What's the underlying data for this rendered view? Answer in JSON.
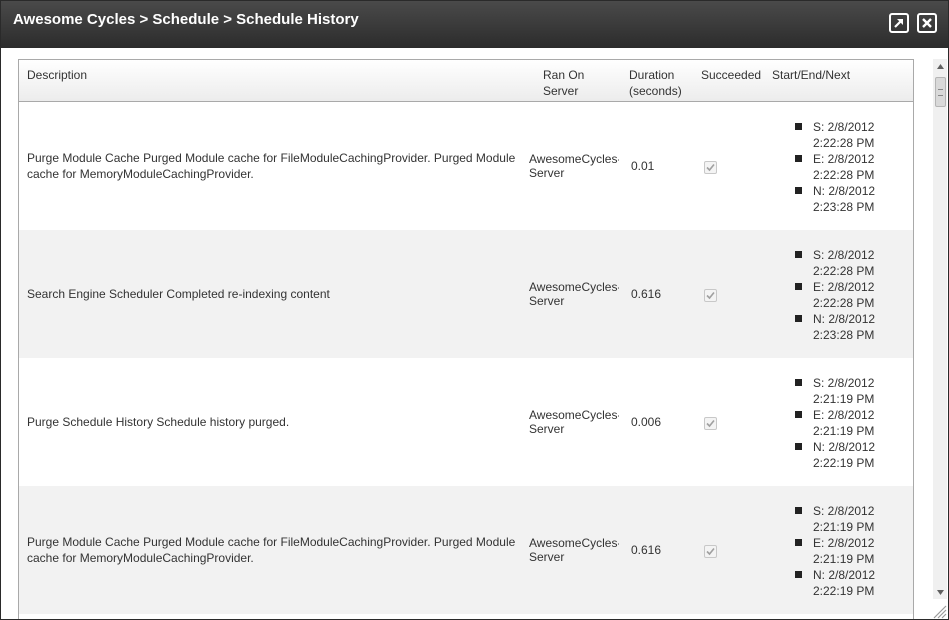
{
  "dialog": {
    "title": "Awesome Cycles > Schedule > Schedule History",
    "maximize_icon": "maximize-icon",
    "close_icon": "close-icon"
  },
  "grid": {
    "columns": {
      "description": "Description",
      "server_line1": "Ran On",
      "server_line2": "Server",
      "duration_line1": "Duration",
      "duration_line2": "(seconds)",
      "succeeded": "Succeeded",
      "times": "Start/End/Next"
    },
    "rows": [
      {
        "description": "Purge Module Cache Purged Module cache for FileModuleCachingProvider. Purged Module cache for MemoryModuleCachingProvider.",
        "server_line1": "AwesomeCycles-",
        "server_line2": "Server",
        "duration": "0.01",
        "succeeded": true,
        "start_date": "S: 2/8/2012",
        "start_time": "2:22:28 PM",
        "end_date": "E: 2/8/2012",
        "end_time": "2:22:28 PM",
        "next_date": "N: 2/8/2012",
        "next_time": "2:23:28 PM"
      },
      {
        "description": "Search Engine Scheduler Completed re-indexing content",
        "server_line1": "AwesomeCycles-",
        "server_line2": "Server",
        "duration": "0.616",
        "succeeded": true,
        "start_date": "S: 2/8/2012",
        "start_time": "2:22:28 PM",
        "end_date": "E: 2/8/2012",
        "end_time": "2:22:28 PM",
        "next_date": "N: 2/8/2012",
        "next_time": "2:23:28 PM"
      },
      {
        "description": "Purge Schedule History Schedule history purged.",
        "server_line1": "AwesomeCycles-",
        "server_line2": "Server",
        "duration": "0.006",
        "succeeded": true,
        "start_date": "S: 2/8/2012",
        "start_time": "2:21:19 PM",
        "end_date": "E: 2/8/2012",
        "end_time": "2:21:19 PM",
        "next_date": "N: 2/8/2012",
        "next_time": "2:22:19 PM"
      },
      {
        "description": "Purge Module Cache Purged Module cache for FileModuleCachingProvider. Purged Module cache for MemoryModuleCachingProvider.",
        "server_line1": "AwesomeCycles-",
        "server_line2": "Server",
        "duration": "0.616",
        "succeeded": true,
        "start_date": "S: 2/8/2012",
        "start_time": "2:21:19 PM",
        "end_date": "E: 2/8/2012",
        "end_time": "2:21:19 PM",
        "next_date": "N: 2/8/2012",
        "next_time": "2:22:19 PM"
      }
    ]
  },
  "colors": {
    "titlebar": "#333333",
    "row_alt": "#f2f2f2",
    "border": "#a9a9a9"
  }
}
